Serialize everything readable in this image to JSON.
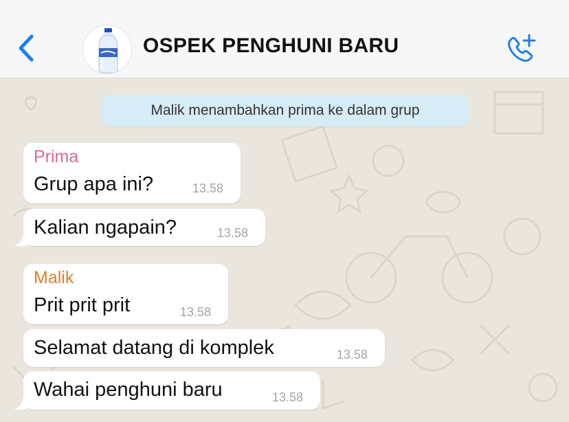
{
  "header": {
    "back_icon": "chevron-left-icon",
    "group_name": "OSPEK PENGHUNI BARU",
    "avatar_icon": "water-bottle-avatar",
    "call_icon": "phone-plus-icon",
    "accent": "#1d7ff0"
  },
  "system_message": "Malik menambahkan prima ke dalam grup",
  "messages": [
    {
      "sender": "Prima",
      "sender_color": "#d36b95",
      "text": "Grup apa ini?",
      "time": "13.58"
    },
    {
      "sender": "",
      "text": "Kalian ngapain?",
      "time": "13.58"
    },
    {
      "sender": "Malik",
      "sender_color": "#e07f2a",
      "text": "Prit prit prit",
      "time": "13.58"
    },
    {
      "sender": "",
      "text": "Selamat datang di komplek",
      "time": "13.58"
    },
    {
      "sender": "",
      "text": "Wahai penghuni baru",
      "time": "13.58"
    }
  ]
}
